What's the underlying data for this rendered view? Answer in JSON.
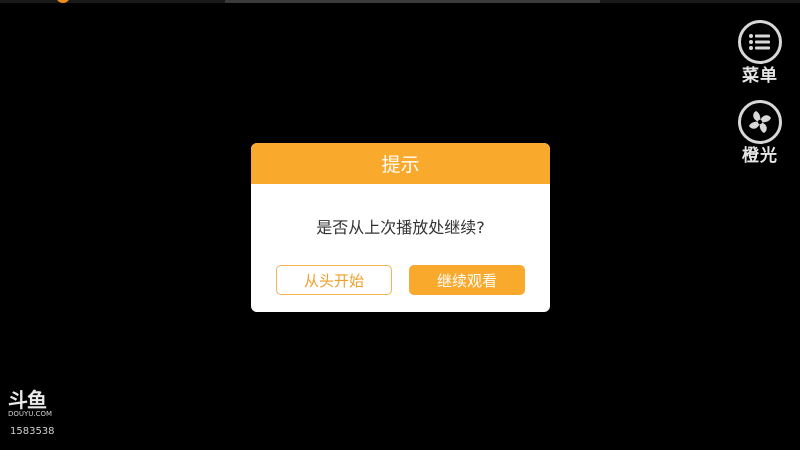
{
  "side_controls": {
    "menu_label": "菜单",
    "menu_icon": "list-menu-icon",
    "orange_label": "橙光",
    "orange_icon": "orange-fan-icon"
  },
  "dialog": {
    "title": "提示",
    "message": "是否从上次播放处继续?",
    "restart_label": "从头开始",
    "continue_label": "继续观看"
  },
  "watermark": {
    "logo_text": "斗鱼",
    "logo_domain": "DOUYU.COM",
    "room_id": "1583538"
  },
  "colors": {
    "accent": "#f9a92b",
    "background": "#000000"
  }
}
